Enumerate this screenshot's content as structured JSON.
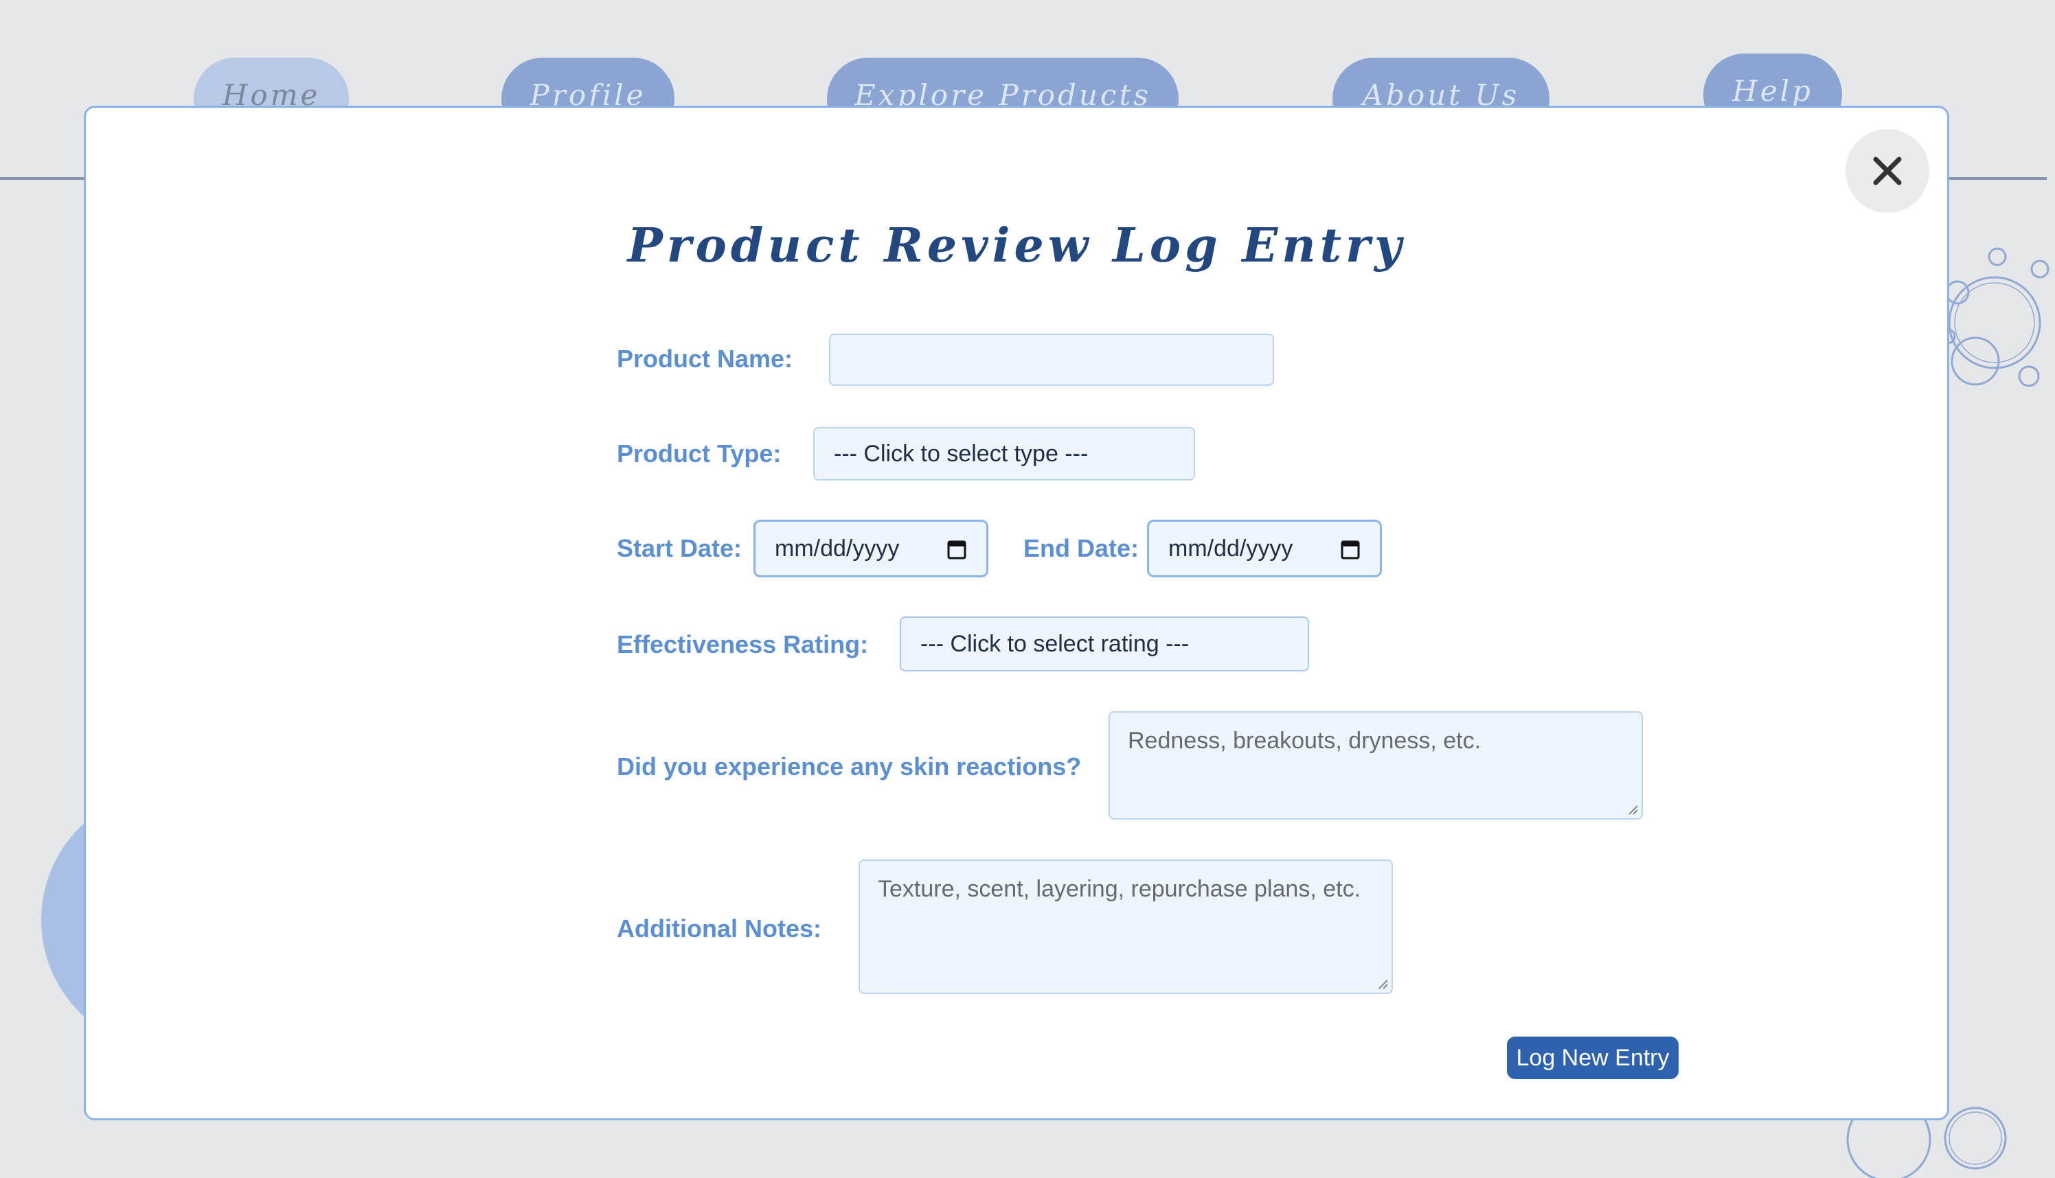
{
  "nav": {
    "items": [
      {
        "label": "Home"
      },
      {
        "label": "Profile"
      },
      {
        "label": "Explore Products"
      },
      {
        "label": "About Us"
      },
      {
        "label": "Help"
      }
    ]
  },
  "modal": {
    "title": "Product Review Log Entry",
    "close_icon": "close-icon",
    "fields": {
      "product_name": {
        "label": "Product Name:",
        "value": ""
      },
      "product_type": {
        "label": "Product Type:",
        "selected": "--- Click to select type ---"
      },
      "start_date": {
        "label": "Start Date:",
        "value": "mm/dd/yyyy"
      },
      "end_date": {
        "label": "End Date:",
        "value": "mm/dd/yyyy"
      },
      "effectiveness": {
        "label": "Effectiveness Rating:",
        "selected": "--- Click to select rating ---"
      },
      "skin_reactions": {
        "label": "Did you experience any skin reactions?",
        "placeholder": "Redness, breakouts, dryness, etc."
      },
      "notes": {
        "label": "Additional Notes:",
        "placeholder": "Texture, scent, layering, repurchase plans, etc."
      }
    },
    "submit_label": "Log New Entry"
  },
  "colors": {
    "accent": "#2f62ae",
    "label": "#5b8fd2",
    "title": "#23477f",
    "field_bg": "#eef5fd",
    "nav_tab": "#8aa5d2"
  }
}
